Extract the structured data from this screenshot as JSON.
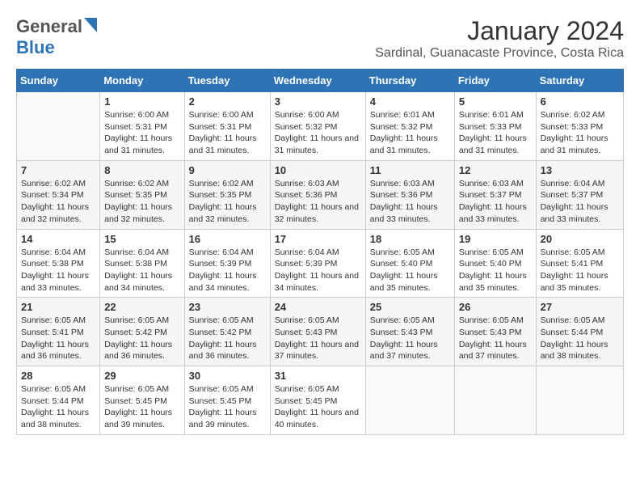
{
  "logo": {
    "general": "General",
    "blue": "Blue"
  },
  "title": "January 2024",
  "subtitle": "Sardinal, Guanacaste Province, Costa Rica",
  "weekdays": [
    "Sunday",
    "Monday",
    "Tuesday",
    "Wednesday",
    "Thursday",
    "Friday",
    "Saturday"
  ],
  "weeks": [
    [
      {
        "day": "",
        "sunrise": "",
        "sunset": "",
        "daylight": ""
      },
      {
        "day": "1",
        "sunrise": "Sunrise: 6:00 AM",
        "sunset": "Sunset: 5:31 PM",
        "daylight": "Daylight: 11 hours and 31 minutes."
      },
      {
        "day": "2",
        "sunrise": "Sunrise: 6:00 AM",
        "sunset": "Sunset: 5:31 PM",
        "daylight": "Daylight: 11 hours and 31 minutes."
      },
      {
        "day": "3",
        "sunrise": "Sunrise: 6:00 AM",
        "sunset": "Sunset: 5:32 PM",
        "daylight": "Daylight: 11 hours and 31 minutes."
      },
      {
        "day": "4",
        "sunrise": "Sunrise: 6:01 AM",
        "sunset": "Sunset: 5:32 PM",
        "daylight": "Daylight: 11 hours and 31 minutes."
      },
      {
        "day": "5",
        "sunrise": "Sunrise: 6:01 AM",
        "sunset": "Sunset: 5:33 PM",
        "daylight": "Daylight: 11 hours and 31 minutes."
      },
      {
        "day": "6",
        "sunrise": "Sunrise: 6:02 AM",
        "sunset": "Sunset: 5:33 PM",
        "daylight": "Daylight: 11 hours and 31 minutes."
      }
    ],
    [
      {
        "day": "7",
        "sunrise": "Sunrise: 6:02 AM",
        "sunset": "Sunset: 5:34 PM",
        "daylight": "Daylight: 11 hours and 32 minutes."
      },
      {
        "day": "8",
        "sunrise": "Sunrise: 6:02 AM",
        "sunset": "Sunset: 5:35 PM",
        "daylight": "Daylight: 11 hours and 32 minutes."
      },
      {
        "day": "9",
        "sunrise": "Sunrise: 6:02 AM",
        "sunset": "Sunset: 5:35 PM",
        "daylight": "Daylight: 11 hours and 32 minutes."
      },
      {
        "day": "10",
        "sunrise": "Sunrise: 6:03 AM",
        "sunset": "Sunset: 5:36 PM",
        "daylight": "Daylight: 11 hours and 32 minutes."
      },
      {
        "day": "11",
        "sunrise": "Sunrise: 6:03 AM",
        "sunset": "Sunset: 5:36 PM",
        "daylight": "Daylight: 11 hours and 33 minutes."
      },
      {
        "day": "12",
        "sunrise": "Sunrise: 6:03 AM",
        "sunset": "Sunset: 5:37 PM",
        "daylight": "Daylight: 11 hours and 33 minutes."
      },
      {
        "day": "13",
        "sunrise": "Sunrise: 6:04 AM",
        "sunset": "Sunset: 5:37 PM",
        "daylight": "Daylight: 11 hours and 33 minutes."
      }
    ],
    [
      {
        "day": "14",
        "sunrise": "Sunrise: 6:04 AM",
        "sunset": "Sunset: 5:38 PM",
        "daylight": "Daylight: 11 hours and 33 minutes."
      },
      {
        "day": "15",
        "sunrise": "Sunrise: 6:04 AM",
        "sunset": "Sunset: 5:38 PM",
        "daylight": "Daylight: 11 hours and 34 minutes."
      },
      {
        "day": "16",
        "sunrise": "Sunrise: 6:04 AM",
        "sunset": "Sunset: 5:39 PM",
        "daylight": "Daylight: 11 hours and 34 minutes."
      },
      {
        "day": "17",
        "sunrise": "Sunrise: 6:04 AM",
        "sunset": "Sunset: 5:39 PM",
        "daylight": "Daylight: 11 hours and 34 minutes."
      },
      {
        "day": "18",
        "sunrise": "Sunrise: 6:05 AM",
        "sunset": "Sunset: 5:40 PM",
        "daylight": "Daylight: 11 hours and 35 minutes."
      },
      {
        "day": "19",
        "sunrise": "Sunrise: 6:05 AM",
        "sunset": "Sunset: 5:40 PM",
        "daylight": "Daylight: 11 hours and 35 minutes."
      },
      {
        "day": "20",
        "sunrise": "Sunrise: 6:05 AM",
        "sunset": "Sunset: 5:41 PM",
        "daylight": "Daylight: 11 hours and 35 minutes."
      }
    ],
    [
      {
        "day": "21",
        "sunrise": "Sunrise: 6:05 AM",
        "sunset": "Sunset: 5:41 PM",
        "daylight": "Daylight: 11 hours and 36 minutes."
      },
      {
        "day": "22",
        "sunrise": "Sunrise: 6:05 AM",
        "sunset": "Sunset: 5:42 PM",
        "daylight": "Daylight: 11 hours and 36 minutes."
      },
      {
        "day": "23",
        "sunrise": "Sunrise: 6:05 AM",
        "sunset": "Sunset: 5:42 PM",
        "daylight": "Daylight: 11 hours and 36 minutes."
      },
      {
        "day": "24",
        "sunrise": "Sunrise: 6:05 AM",
        "sunset": "Sunset: 5:43 PM",
        "daylight": "Daylight: 11 hours and 37 minutes."
      },
      {
        "day": "25",
        "sunrise": "Sunrise: 6:05 AM",
        "sunset": "Sunset: 5:43 PM",
        "daylight": "Daylight: 11 hours and 37 minutes."
      },
      {
        "day": "26",
        "sunrise": "Sunrise: 6:05 AM",
        "sunset": "Sunset: 5:43 PM",
        "daylight": "Daylight: 11 hours and 37 minutes."
      },
      {
        "day": "27",
        "sunrise": "Sunrise: 6:05 AM",
        "sunset": "Sunset: 5:44 PM",
        "daylight": "Daylight: 11 hours and 38 minutes."
      }
    ],
    [
      {
        "day": "28",
        "sunrise": "Sunrise: 6:05 AM",
        "sunset": "Sunset: 5:44 PM",
        "daylight": "Daylight: 11 hours and 38 minutes."
      },
      {
        "day": "29",
        "sunrise": "Sunrise: 6:05 AM",
        "sunset": "Sunset: 5:45 PM",
        "daylight": "Daylight: 11 hours and 39 minutes."
      },
      {
        "day": "30",
        "sunrise": "Sunrise: 6:05 AM",
        "sunset": "Sunset: 5:45 PM",
        "daylight": "Daylight: 11 hours and 39 minutes."
      },
      {
        "day": "31",
        "sunrise": "Sunrise: 6:05 AM",
        "sunset": "Sunset: 5:45 PM",
        "daylight": "Daylight: 11 hours and 40 minutes."
      },
      {
        "day": "",
        "sunrise": "",
        "sunset": "",
        "daylight": ""
      },
      {
        "day": "",
        "sunrise": "",
        "sunset": "",
        "daylight": ""
      },
      {
        "day": "",
        "sunrise": "",
        "sunset": "",
        "daylight": ""
      }
    ]
  ]
}
